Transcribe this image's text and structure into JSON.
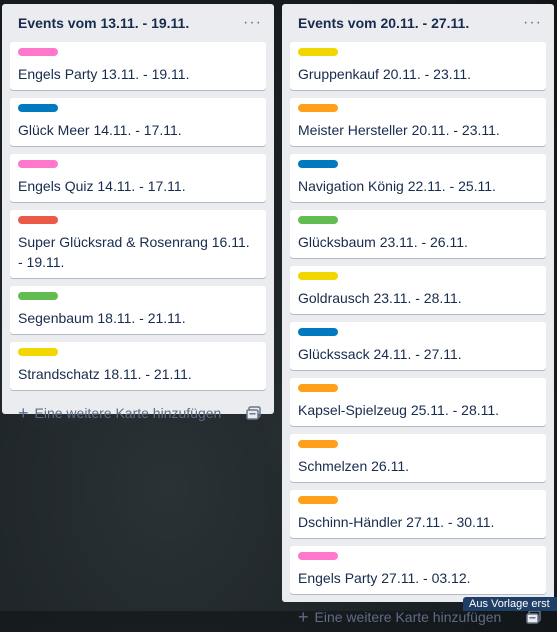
{
  "lists": [
    {
      "title": "Events vom 13.11. - 19.11.",
      "menu_icon": "more-horizontal-icon",
      "add_card_label": "Eine weitere Karte hinzufügen",
      "cards": [
        {
          "title": "Engels Party 13.11. - 19.11.",
          "label_color": "#ff78cb"
        },
        {
          "title": "Glück Meer 14.11. - 17.11.",
          "label_color": "#0079bf"
        },
        {
          "title": "Engels Quiz 14.11. - 17.11.",
          "label_color": "#ff78cb"
        },
        {
          "title": "Super Glücksrad & Rosenrang 16.11. - 19.11.",
          "label_color": "#eb5a46"
        },
        {
          "title": "Segenbaum 18.11. - 21.11.",
          "label_color": "#61bd4f"
        },
        {
          "title": "Strandschatz 18.11. - 21.11.",
          "label_color": "#f2d600"
        }
      ]
    },
    {
      "title": "Events vom 20.11. - 27.11.",
      "menu_icon": "more-horizontal-icon",
      "add_card_label": "Eine weitere Karte hinzufügen",
      "cards": [
        {
          "title": "Gruppenkauf 20.11. - 23.11.",
          "label_color": "#f2d600"
        },
        {
          "title": "Meister Hersteller 20.11. - 23.11.",
          "label_color": "#ff9f1a"
        },
        {
          "title": "Navigation König 22.11. - 25.11.",
          "label_color": "#0079bf"
        },
        {
          "title": "Glücksbaum 23.11. - 26.11.",
          "label_color": "#61bd4f"
        },
        {
          "title": "Goldrausch 23.11. - 28.11.",
          "label_color": "#f2d600"
        },
        {
          "title": "Glückssack 24.11. - 27.11.",
          "label_color": "#0079bf"
        },
        {
          "title": "Kapsel-Spielzeug 25.11. - 28.11.",
          "label_color": "#ff9f1a"
        },
        {
          "title": "Schmelzen 26.11.",
          "label_color": "#ff9f1a"
        },
        {
          "title": "Dschinn-Händler 27.11. - 30.11.",
          "label_color": "#ff9f1a"
        },
        {
          "title": "Engels Party 27.11. - 03.12.",
          "label_color": "#ff78cb"
        }
      ]
    }
  ],
  "footer": {
    "text": "Aus Vorlage erst"
  }
}
